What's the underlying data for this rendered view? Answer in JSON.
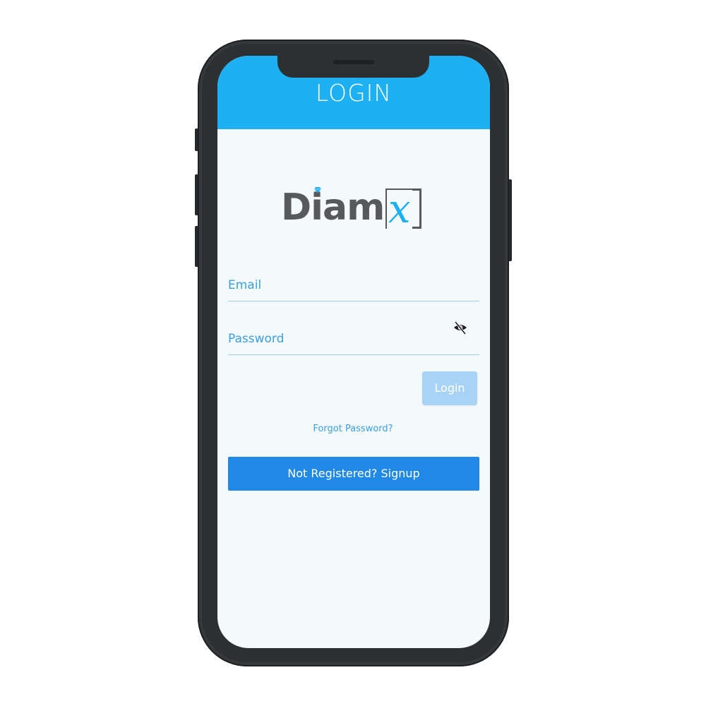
{
  "header": {
    "title": "LOGIN",
    "background_color": "#1db1f3"
  },
  "logo": {
    "text_main": "Diam",
    "text_accent": "x",
    "main_color": "#58595b",
    "accent_color": "#1db1f3"
  },
  "form": {
    "email_placeholder": "Email",
    "password_placeholder": "Password",
    "password_toggle_icon": "eye-off-icon",
    "login_label": "Login",
    "login_color": "#a8d3f4",
    "forgot_label": "Forgot Password?",
    "signup_label": "Not Registered? Signup",
    "signup_color": "#2089e5"
  }
}
